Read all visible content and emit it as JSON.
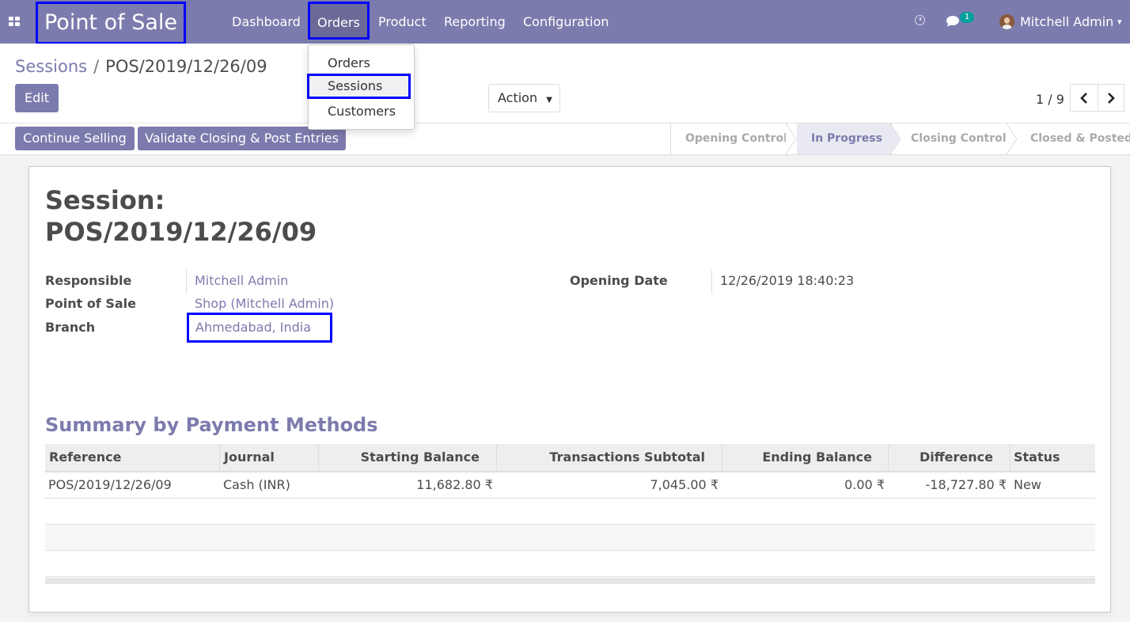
{
  "navbar": {
    "brand": "Point of Sale",
    "menu": [
      "Dashboard",
      "Orders",
      "Product",
      "Reporting",
      "Configuration"
    ],
    "chat_badge": "1",
    "user": "Mitchell Admin"
  },
  "dropdown": {
    "items": [
      "Orders",
      "Sessions",
      "Customers"
    ]
  },
  "breadcrumb": {
    "parent": "Sessions",
    "separator": "/",
    "current": "POS/2019/12/26/09"
  },
  "buttons": {
    "edit": "Edit",
    "action": "Action",
    "continue_selling": "Continue Selling",
    "validate": "Validate Closing & Post Entries"
  },
  "pager": {
    "value": "1 / 9"
  },
  "status_steps": {
    "items": [
      "Opening Control",
      "In Progress",
      "Closing Control",
      "Closed & Posted"
    ],
    "active": "In Progress"
  },
  "form": {
    "title_line1": "Session:",
    "title_line2": "POS/2019/12/26/09",
    "fields": {
      "responsible_label": "Responsible",
      "responsible_value": "Mitchell Admin",
      "pos_label": "Point of Sale",
      "pos_value": "Shop (Mitchell Admin)",
      "branch_label": "Branch",
      "branch_value": "Ahmedabad, India",
      "opening_date_label": "Opening Date",
      "opening_date_value": "12/26/2019 18:40:23"
    }
  },
  "summary": {
    "title": "Summary by Payment Methods",
    "columns": [
      "Reference",
      "Journal",
      "Starting Balance",
      "Transactions Subtotal",
      "Ending Balance",
      "Difference",
      "Status"
    ],
    "rows": [
      [
        "POS/2019/12/26/09",
        "Cash (INR)",
        "11,682.80 ₹",
        "7,045.00 ₹",
        "0.00 ₹",
        "-18,727.80 ₹",
        "New"
      ]
    ]
  },
  "colors": {
    "brand": "#7c7bad",
    "highlight_box": "#0000ff",
    "badge": "#00a09d"
  }
}
